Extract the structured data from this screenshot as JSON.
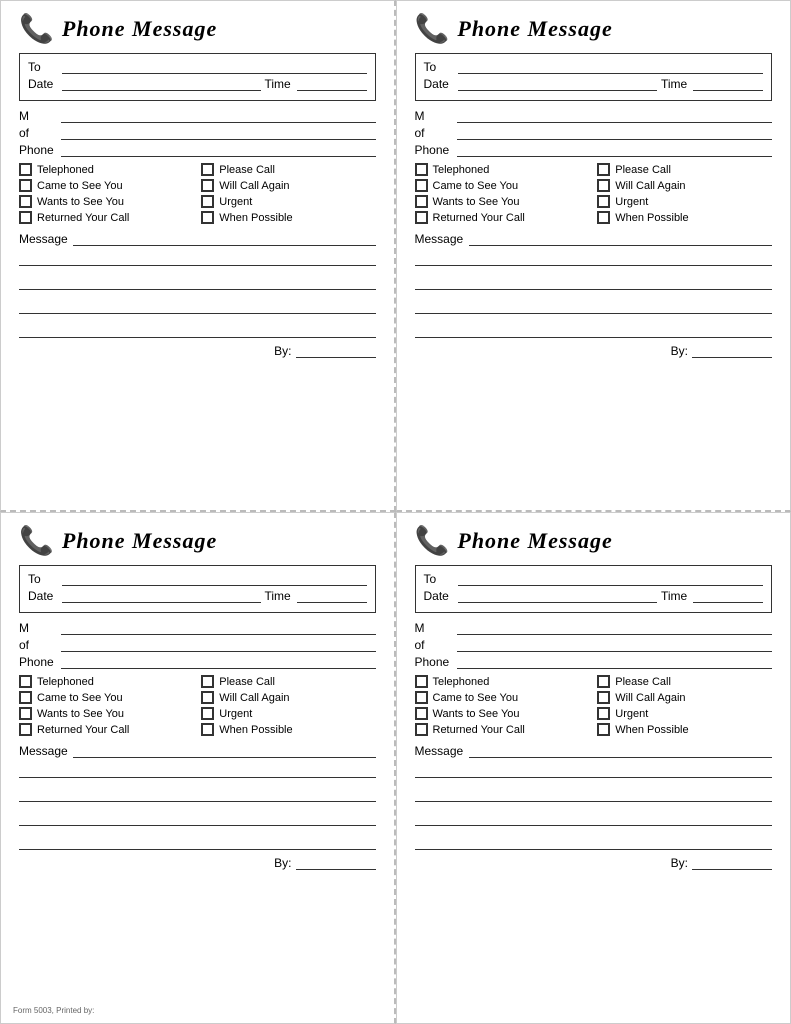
{
  "cards": [
    {
      "id": "top-left",
      "title": "Phone Message",
      "checkboxes": [
        {
          "label": "Telephoned"
        },
        {
          "label": "Please Call"
        },
        {
          "label": "Came to See You"
        },
        {
          "label": "Will Call Again"
        },
        {
          "label": "Wants to See You"
        },
        {
          "label": "Urgent"
        },
        {
          "label": "Returned Your Call"
        },
        {
          "label": "When Possible"
        }
      ],
      "footer_note": ""
    },
    {
      "id": "top-right",
      "title": "Phone Message",
      "checkboxes": [
        {
          "label": "Telephoned"
        },
        {
          "label": "Please Call"
        },
        {
          "label": "Came to See You"
        },
        {
          "label": "Will Call Again"
        },
        {
          "label": "Wants to See You"
        },
        {
          "label": "Urgent"
        },
        {
          "label": "Returned Your Call"
        },
        {
          "label": "When Possible"
        }
      ],
      "footer_note": ""
    },
    {
      "id": "bottom-left",
      "title": "Phone Message",
      "checkboxes": [
        {
          "label": "Telephoned"
        },
        {
          "label": "Please Call"
        },
        {
          "label": "Came to See You"
        },
        {
          "label": "Will Call Again"
        },
        {
          "label": "Wants to See You"
        },
        {
          "label": "Urgent"
        },
        {
          "label": "Returned Your Call"
        },
        {
          "label": "When Possible"
        }
      ],
      "footer_note": "Form 5003, Printed by:"
    },
    {
      "id": "bottom-right",
      "title": "Phone Message",
      "checkboxes": [
        {
          "label": "Telephoned"
        },
        {
          "label": "Please Call"
        },
        {
          "label": "Came to See You"
        },
        {
          "label": "Will Call Again"
        },
        {
          "label": "Wants to See You"
        },
        {
          "label": "Urgent"
        },
        {
          "label": "Returned Your Call"
        },
        {
          "label": "When Possible"
        }
      ],
      "footer_note": ""
    }
  ],
  "labels": {
    "to": "To",
    "date": "Date",
    "time": "Time",
    "m": "M",
    "of": "of",
    "phone": "Phone",
    "message": "Message",
    "by": "By:"
  }
}
